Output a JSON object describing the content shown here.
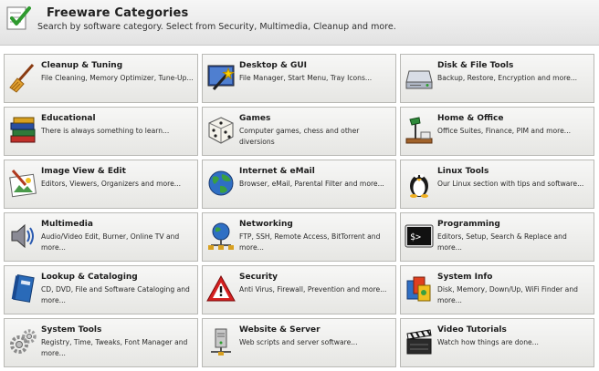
{
  "header": {
    "title": "Freeware Categories",
    "subtitle": "Search by software category. Select from Security, Multimedia, Cleanup and more."
  },
  "categories": [
    {
      "title": "Cleanup & Tuning",
      "desc": "File Cleaning, Memory Optimizer, Tune-Up...",
      "icon": "broom-icon"
    },
    {
      "title": "Desktop & GUI",
      "desc": "File Manager, Start Menu, Tray Icons...",
      "icon": "magic-wand-icon"
    },
    {
      "title": "Disk & File Tools",
      "desc": "Backup, Restore, Encryption and more...",
      "icon": "hard-drive-icon"
    },
    {
      "title": "Educational",
      "desc": "There is always something to learn...",
      "icon": "books-icon"
    },
    {
      "title": "Games",
      "desc": "Computer games, chess and other diversions",
      "icon": "dice-icon"
    },
    {
      "title": "Home & Office",
      "desc": "Office Suites, Finance, PIM and more...",
      "icon": "desk-lamp-icon"
    },
    {
      "title": "Image View & Edit",
      "desc": "Editors, Viewers, Organizers and more...",
      "icon": "paint-brush-icon"
    },
    {
      "title": "Internet & eMail",
      "desc": "Browser, eMail, Parental Filter and more...",
      "icon": "globe-icon"
    },
    {
      "title": "Linux Tools",
      "desc": "Our Linux section with tips and software...",
      "icon": "penguin-icon"
    },
    {
      "title": "Multimedia",
      "desc": "Audio/Video Edit, Burner, Online TV and more...",
      "icon": "speaker-icon"
    },
    {
      "title": "Networking",
      "desc": "FTP, SSH, Remote Access, BitTorrent and more...",
      "icon": "network-icon"
    },
    {
      "title": "Programming",
      "desc": "Editors, Setup, Search & Replace and more...",
      "icon": "terminal-icon"
    },
    {
      "title": "Lookup & Cataloging",
      "desc": "CD, DVD, File and Software Cataloging and more...",
      "icon": "notebook-icon"
    },
    {
      "title": "Security",
      "desc": "Anti Virus, Firewall, Prevention and more...",
      "icon": "warning-icon"
    },
    {
      "title": "System Info",
      "desc": "Disk, Memory, Down/Up, WiFi Finder and more...",
      "icon": "system-info-icon"
    },
    {
      "title": "System Tools",
      "desc": "Registry, Time, Tweaks, Font Manager and more...",
      "icon": "gears-icon"
    },
    {
      "title": "Website & Server",
      "desc": "Web scripts and server software...",
      "icon": "server-icon"
    },
    {
      "title": "Video Tutorials",
      "desc": "Watch how things are done...",
      "icon": "clapperboard-icon"
    }
  ]
}
